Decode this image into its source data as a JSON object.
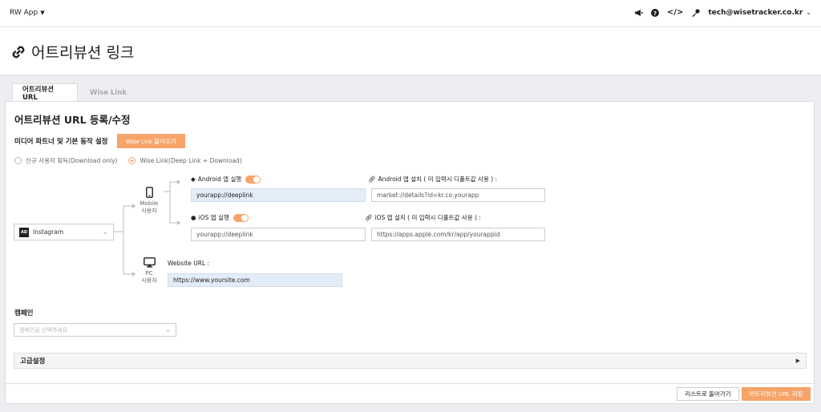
{
  "topbar": {
    "app_name": "RW App",
    "user_email": "tech@wisetracker.co.kr",
    "icons": [
      "megaphone-icon",
      "help-icon",
      "code-icon",
      "key-icon"
    ]
  },
  "page": {
    "title": "어트리뷰션 링크"
  },
  "tabs": [
    {
      "label": "어트리뷰션 URL",
      "active": true
    },
    {
      "label": "Wise Link",
      "active": false
    }
  ],
  "form": {
    "section_title": "어트리뷰션 URL 등록/수정",
    "media_setting_title": "미디어 파트너 및 기본 동작 설정",
    "wiselink_button": "Wise Link 불러오기",
    "radio_options": [
      {
        "label": "신규 사용자 획득(Download only)",
        "selected": false
      },
      {
        "label": "Wise Link(Deep Link + Download)",
        "selected": true
      }
    ],
    "media": {
      "badge": "AD",
      "value": "Instagram"
    },
    "mobile_label": "Mobile",
    "mobile_sub": "사용자",
    "pc_label": "PC",
    "pc_sub": "사용자",
    "android_run_label": "Android 앱 실행",
    "android_run_value": "yourapp://deeplink",
    "android_install_label": "Android 앱 설치 ( 미 입력시 디폴트값 사용 ) :",
    "android_install_value": "market://details?id=kr.co.yourapp",
    "ios_run_label": "iOS 앱 실행",
    "ios_run_value": "yourapp://deeplink",
    "ios_install_label": "iOS 앱 설치 ( 미 입력시 디폴트값 사용 ) :",
    "ios_install_value": "https://apps.apple.com/kr/app/yourappid",
    "website_label": "Website URL :",
    "website_value": "https://www.yoursite.com",
    "campaign_title": "캠페인",
    "campaign_placeholder": "캠페인을 선택하세요",
    "advanced_title": "고급설정"
  },
  "footer": {
    "back_label": "리스트로 돌아가기",
    "save_label": "어트리뷰션 URL 저장"
  },
  "colors": {
    "accent": "#f6a46a",
    "input_highlight": "#e3edf8"
  }
}
